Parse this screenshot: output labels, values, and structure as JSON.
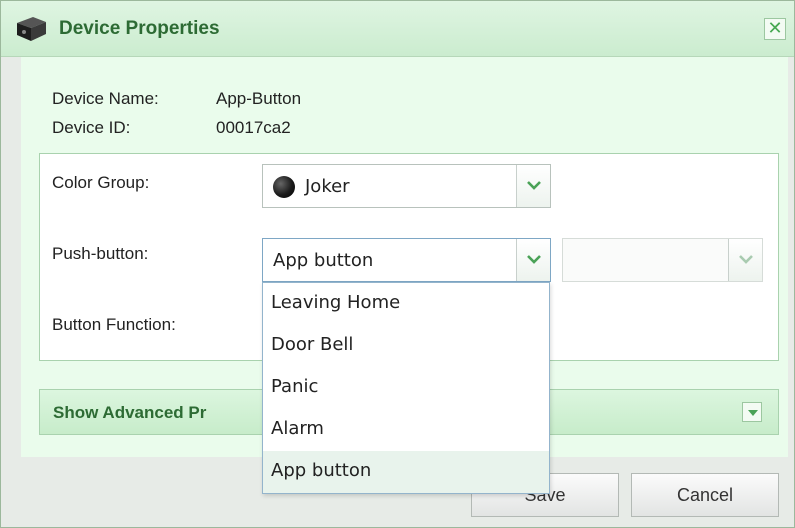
{
  "dialog": {
    "title": "Device Properties",
    "close_glyph": "✕"
  },
  "info": {
    "name_label": "Device Name:",
    "name_value": "App-Button",
    "id_label": "Device ID:",
    "id_value": "00017ca2"
  },
  "fields": {
    "color_group_label": "Color Group:",
    "color_group_value": "Joker",
    "push_button_label": "Push-button:",
    "push_button_value": "App button",
    "secondary_value": "",
    "button_function_label": "Button Function:"
  },
  "dropdown": {
    "options": [
      "Leaving Home",
      "Door Bell",
      "Panic",
      "Alarm",
      "App button"
    ],
    "selected": "App button"
  },
  "advanced": {
    "label_visible": "Show Advanced Pr"
  },
  "buttons": {
    "save": "Save",
    "cancel": "Cancel"
  },
  "colors": {
    "accent_green": "#2d6b34",
    "title_gradient": "#dff5e2",
    "joker_dot": "#000000"
  },
  "icons": {
    "title": "device-icon",
    "close": "close-icon",
    "combo_arrow": "chevron-down-icon"
  }
}
